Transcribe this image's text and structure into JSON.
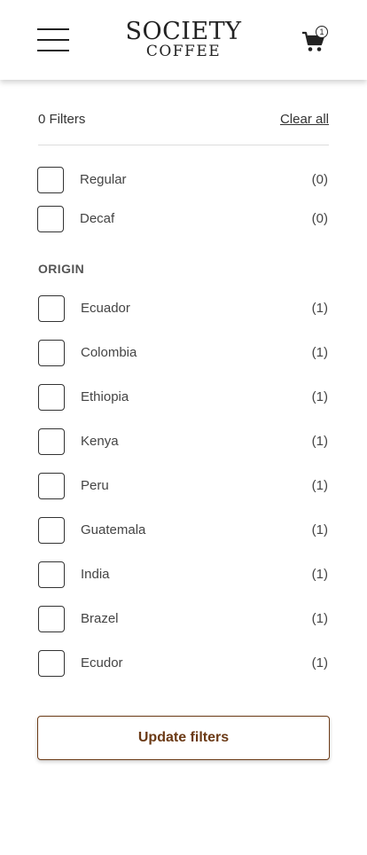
{
  "header": {
    "logo_line1": "SOCIETY",
    "logo_line2": "COFFEE",
    "menu_icon": "hamburger-menu-icon",
    "cart_icon": "shopping-cart-icon",
    "cart_count": "1"
  },
  "filters": {
    "count_label": "0 Filters",
    "clear_label": "Clear all"
  },
  "type_options": [
    {
      "label": "Regular",
      "count": "(0)"
    },
    {
      "label": "Decaf",
      "count": "(0)"
    }
  ],
  "origin": {
    "title": "ORIGIN",
    "options": [
      {
        "label": "Ecuador",
        "count": "(1)"
      },
      {
        "label": "Colombia",
        "count": "(1)"
      },
      {
        "label": "Ethiopia",
        "count": "(1)"
      },
      {
        "label": "Kenya",
        "count": "(1)"
      },
      {
        "label": "Peru",
        "count": "(1)"
      },
      {
        "label": "Guatemala",
        "count": "(1)"
      },
      {
        "label": "India",
        "count": "(1)"
      },
      {
        "label": "Brazel",
        "count": "(1)"
      },
      {
        "label": "Ecudor",
        "count": "(1)"
      }
    ]
  },
  "actions": {
    "update_label": "Update filters"
  },
  "colors": {
    "accent": "#6b3a16",
    "text": "#333333",
    "divider": "#dddddd"
  }
}
